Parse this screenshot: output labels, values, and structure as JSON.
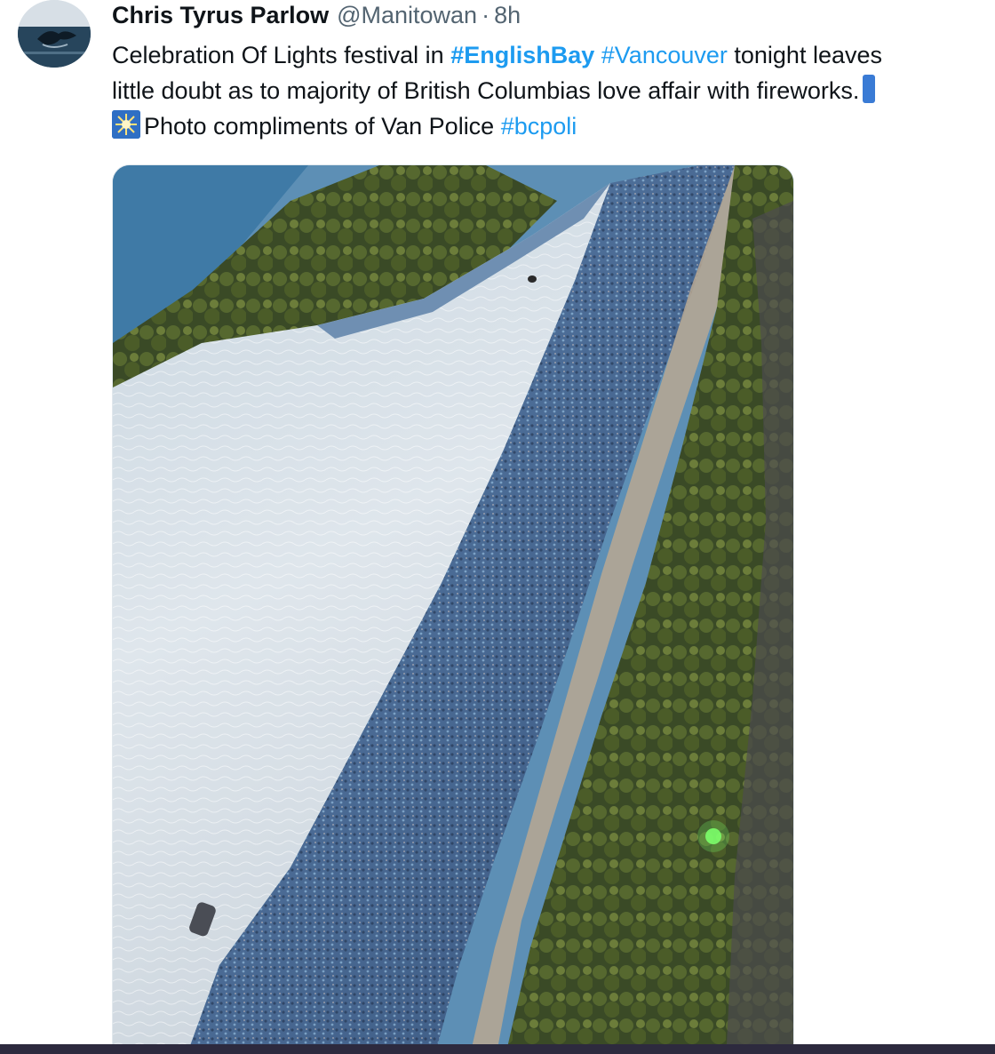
{
  "tweet": {
    "author_name": "Chris Tyrus Parlow",
    "author_handle": "@Manitowan",
    "separator": "·",
    "timestamp": "8h",
    "text_line1_prefix": "Celebration Of Lights festival in ",
    "hashtag1": "#EnglishBay",
    "hashtag2": "#Vancouver",
    "text_line1_suffix": " tonight leaves",
    "text_line2": "little doubt as to majority of British Columbias love affair with fireworks.",
    "text_line3": "Photo compliments of Van Police ",
    "hashtag3": "#bcpoli",
    "emoji": "fireworks-sparkler-icon"
  },
  "colors": {
    "link": "#1d9bf0",
    "text": "#0f1419",
    "muted": "#536471"
  }
}
